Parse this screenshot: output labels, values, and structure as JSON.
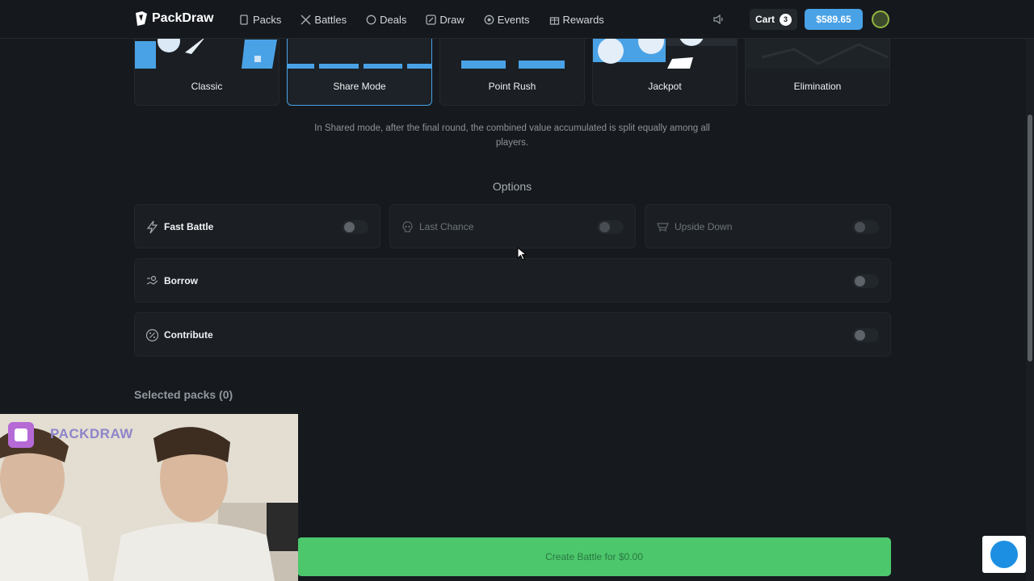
{
  "brand": {
    "name": "PackDraw"
  },
  "nav": {
    "items": [
      {
        "label": "Packs",
        "icon": "pack-icon"
      },
      {
        "label": "Battles",
        "icon": "swords-icon"
      },
      {
        "label": "Deals",
        "icon": "deals-icon"
      },
      {
        "label": "Draw",
        "icon": "draw-icon"
      },
      {
        "label": "Events",
        "icon": "events-icon"
      },
      {
        "label": "Rewards",
        "icon": "gift-icon"
      }
    ]
  },
  "header": {
    "cart_label": "Cart",
    "cart_count": "3",
    "balance": "$589.65"
  },
  "modes": {
    "items": [
      {
        "label": "Classic"
      },
      {
        "label": "Share Mode",
        "selected": true
      },
      {
        "label": "Point Rush"
      },
      {
        "label": "Jackpot"
      },
      {
        "label": "Elimination"
      }
    ],
    "description": "In Shared mode, after the final round, the combined value accumulated is split equally among all players."
  },
  "options": {
    "title": "Options",
    "fast_battle": {
      "label": "Fast Battle",
      "icon": "lightning-icon",
      "enabled": false
    },
    "last_chance": {
      "label": "Last Chance",
      "icon": "skull-icon",
      "enabled": false,
      "disabled": true
    },
    "upside_down": {
      "label": "Upside Down",
      "icon": "upside-down-icon",
      "enabled": false,
      "disabled": true
    },
    "borrow": {
      "label": "Borrow",
      "icon": "borrow-icon",
      "enabled": false
    },
    "contribute": {
      "label": "Contribute",
      "icon": "percent-icon",
      "enabled": false
    }
  },
  "selected_packs": {
    "label": "Selected packs (0)"
  },
  "create_button": {
    "label": "Create Battle for $0.00"
  },
  "colors": {
    "background": "#161a1e",
    "accent_blue": "#4aa2e6",
    "create_green": "#4cc76c"
  }
}
